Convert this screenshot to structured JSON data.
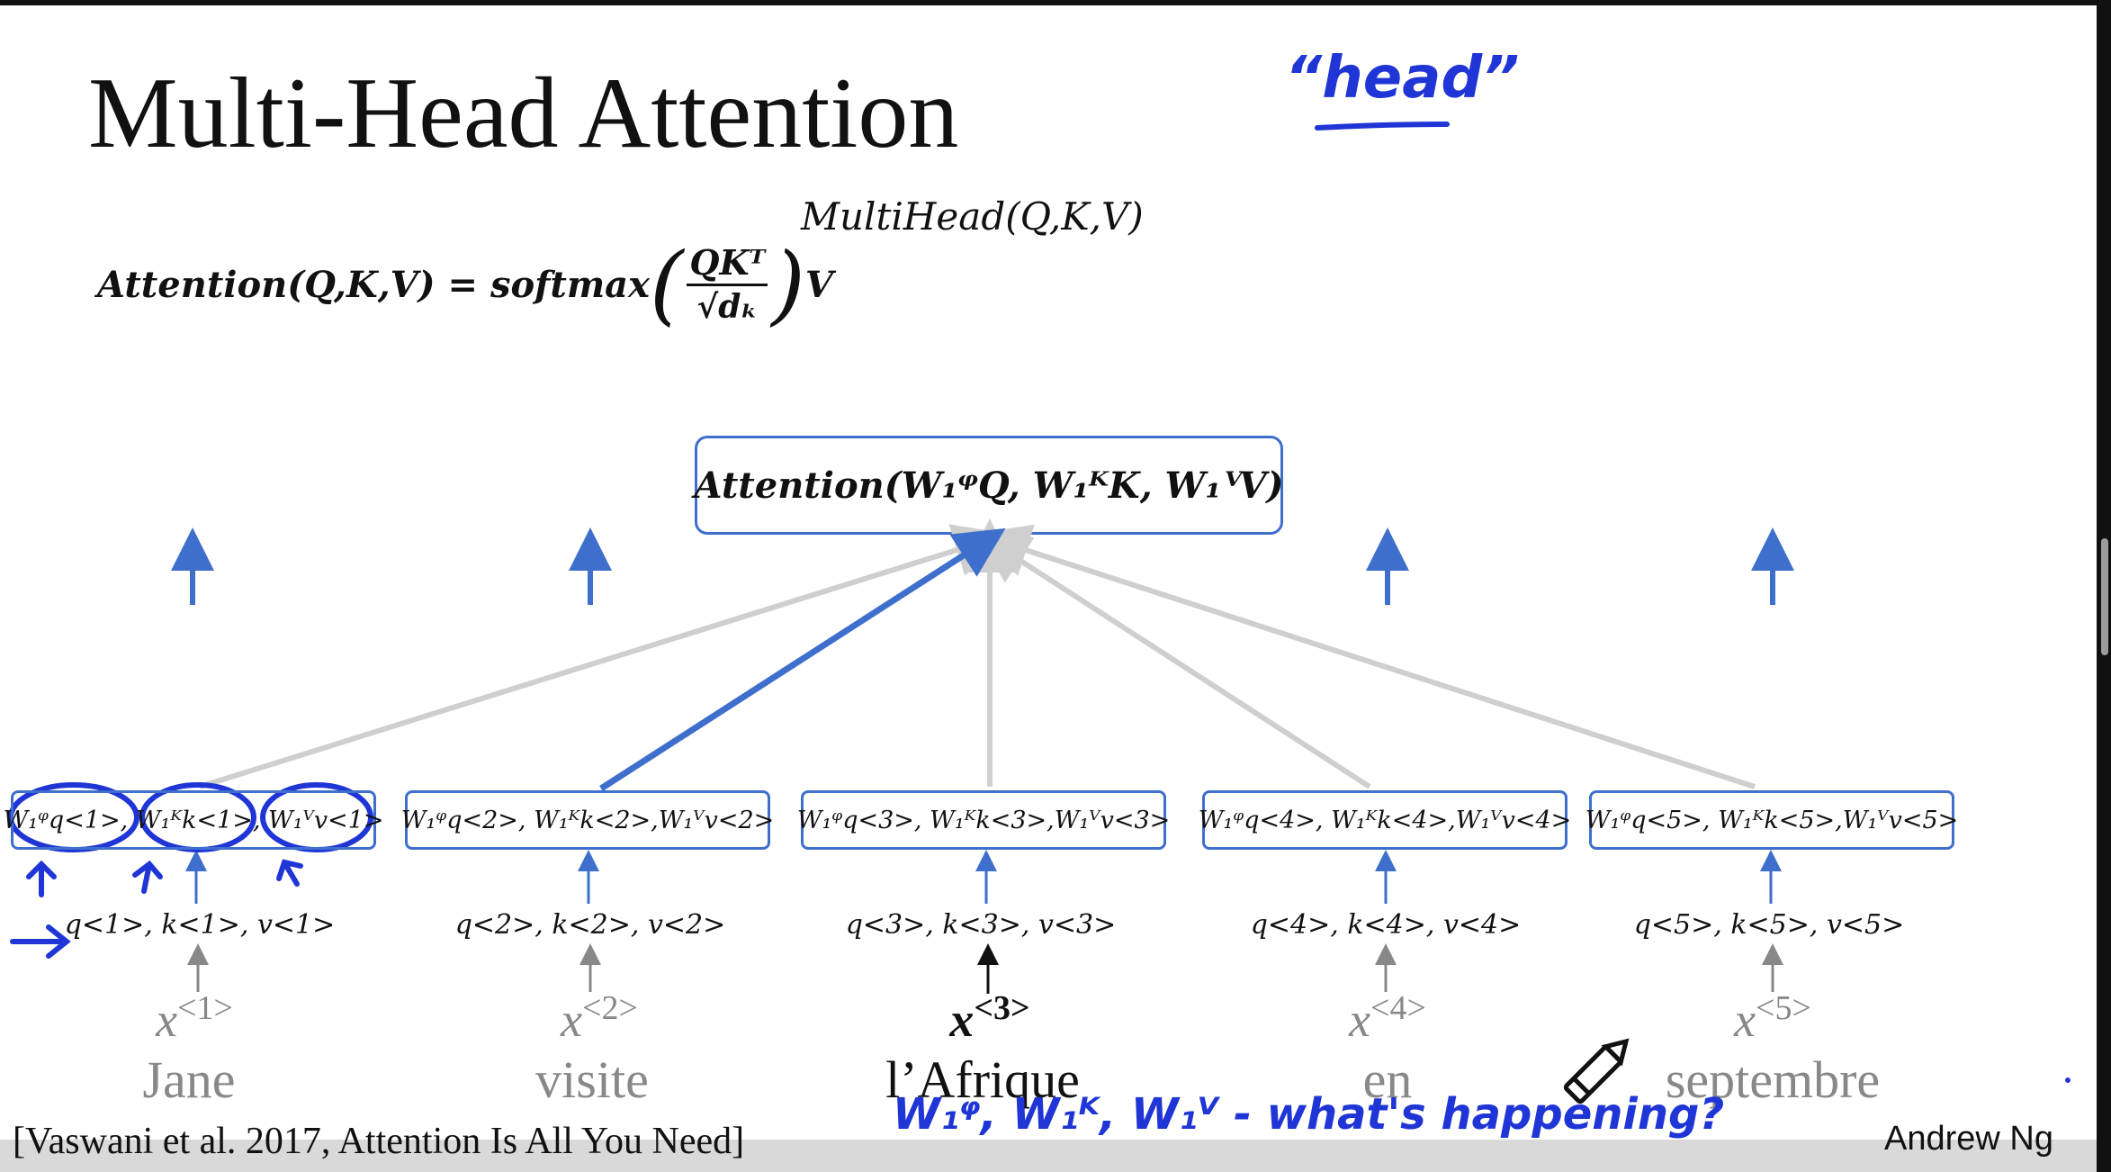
{
  "title": "Multi-Head Attention",
  "multihead_label": "MultiHead(Q,K,V)",
  "attention_formula": {
    "lhs": "Attention(Q,K,V) = softmax",
    "numerator": "QKᵀ",
    "denominator": "√dₖ",
    "rhs": "V"
  },
  "head_box": "Attention(W₁ᵠQ, W₁ᴷK, W₁ⱽV)",
  "tokens": [
    {
      "weighted": "W₁ᵠq<1>, W₁ᴷk<1>, W₁ⱽv<1>",
      "qkv": "q<1>, k<1>, v<1>",
      "x": "x",
      "x_sup": "<1>",
      "word": "Jane"
    },
    {
      "weighted": "W₁ᵠq<2>, W₁ᴷk<2>,W₁ⱽv<2>",
      "qkv": "q<2>, k<2>, v<2>",
      "x": "x",
      "x_sup": "<2>",
      "word": "visite"
    },
    {
      "weighted": "W₁ᵠq<3>, W₁ᴷk<3>,W₁ⱽv<3>",
      "qkv": "q<3>, k<3>, v<3>",
      "x": "x",
      "x_sup": "<3>",
      "word": "l’Afrique"
    },
    {
      "weighted": "W₁ᵠq<4>, W₁ᴷk<4>,W₁ⱽv<4>",
      "qkv": "q<4>, k<4>, v<4>",
      "x": "x",
      "x_sup": "<4>",
      "word": "en"
    },
    {
      "weighted": "W₁ᵠq<5>, W₁ᴷk<5>,W₁ⱽv<5>",
      "qkv": "q<5>, k<5>, v<5>",
      "x": "x",
      "x_sup": "<5>",
      "word": "septembre"
    }
  ],
  "citation": "[Vaswani et al. 2017, Attention Is All You Need]",
  "author": "Andrew Ng",
  "annotations": {
    "head": "“head”",
    "note": "W₁ᵠ, W₁ᴷ, W₁ⱽ - what's happening?"
  },
  "icons": [
    "pencil-icon"
  ],
  "colors": {
    "accent": "#3e6fcc",
    "ink": "#1f35d6",
    "gray_arrow": "#cfcfcf"
  }
}
